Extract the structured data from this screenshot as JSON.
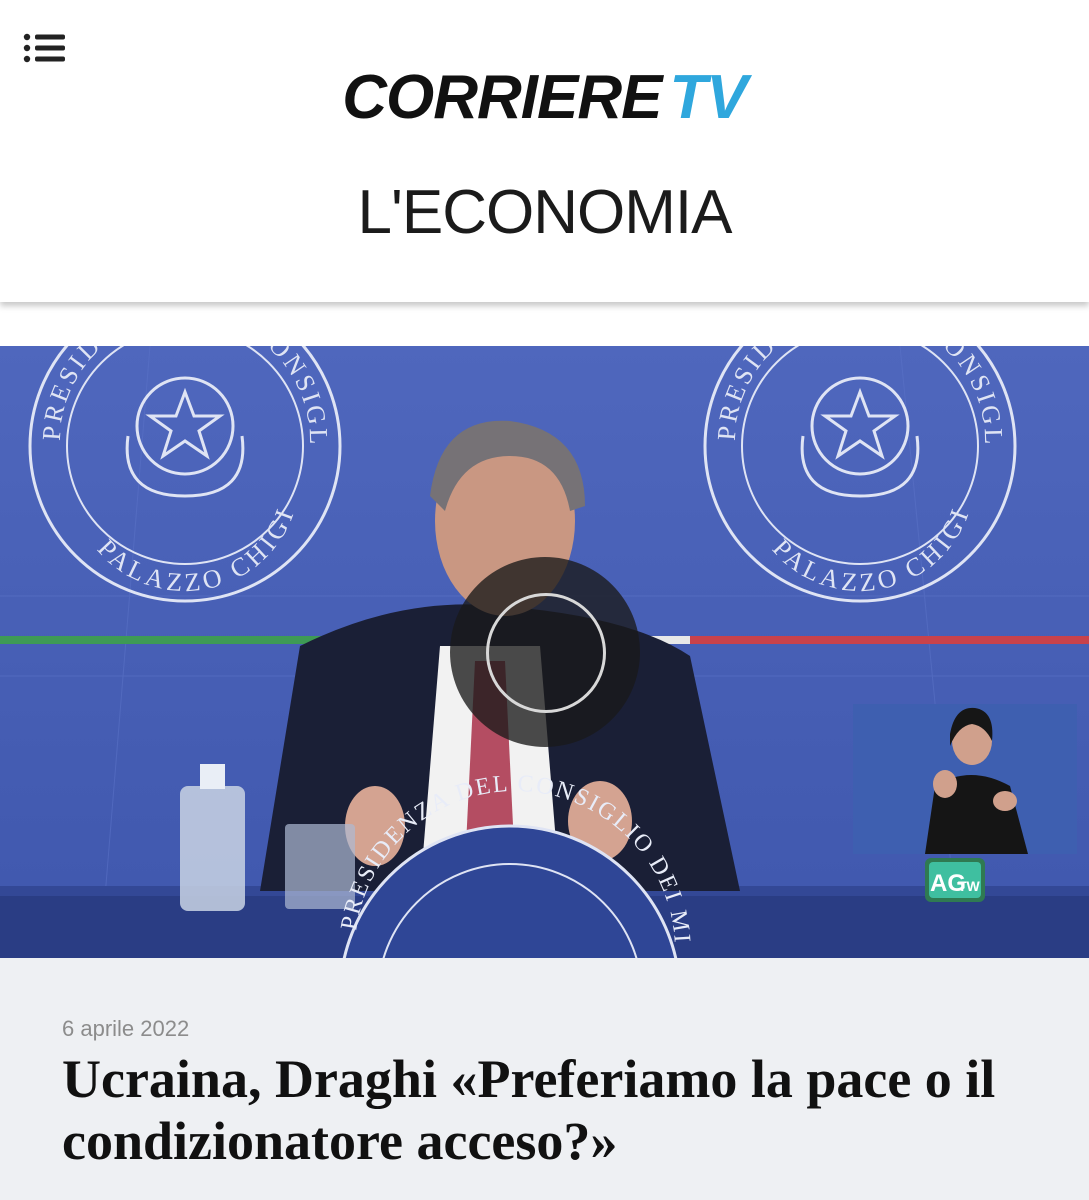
{
  "header": {
    "menu_icon": "menu-list-icon",
    "logo_brand": "CORRIERE",
    "logo_tv": "TV",
    "section_title": "L'ECONOMIA"
  },
  "video": {
    "emblem_top_text": "PRESIDENZA DEL CONSIGLIO DEI MINISTRI",
    "emblem_bottom_text": "PALAZZO CHIGI",
    "podium_text": "PRESIDENZA DEL CONSIGLIO DEI MINISTRI",
    "channel_badge": "AG",
    "channel_badge_sub": "TW",
    "play_icon": "play-icon"
  },
  "article": {
    "date": "6 aprile 2022",
    "title": "Ucraina, Draghi «Preferiamo la pace o il condizionatore acceso?»"
  },
  "colors": {
    "logo_tv": "#2fa7dd",
    "backdrop_blue": "#4a62b8",
    "info_background": "#eef0f3"
  }
}
